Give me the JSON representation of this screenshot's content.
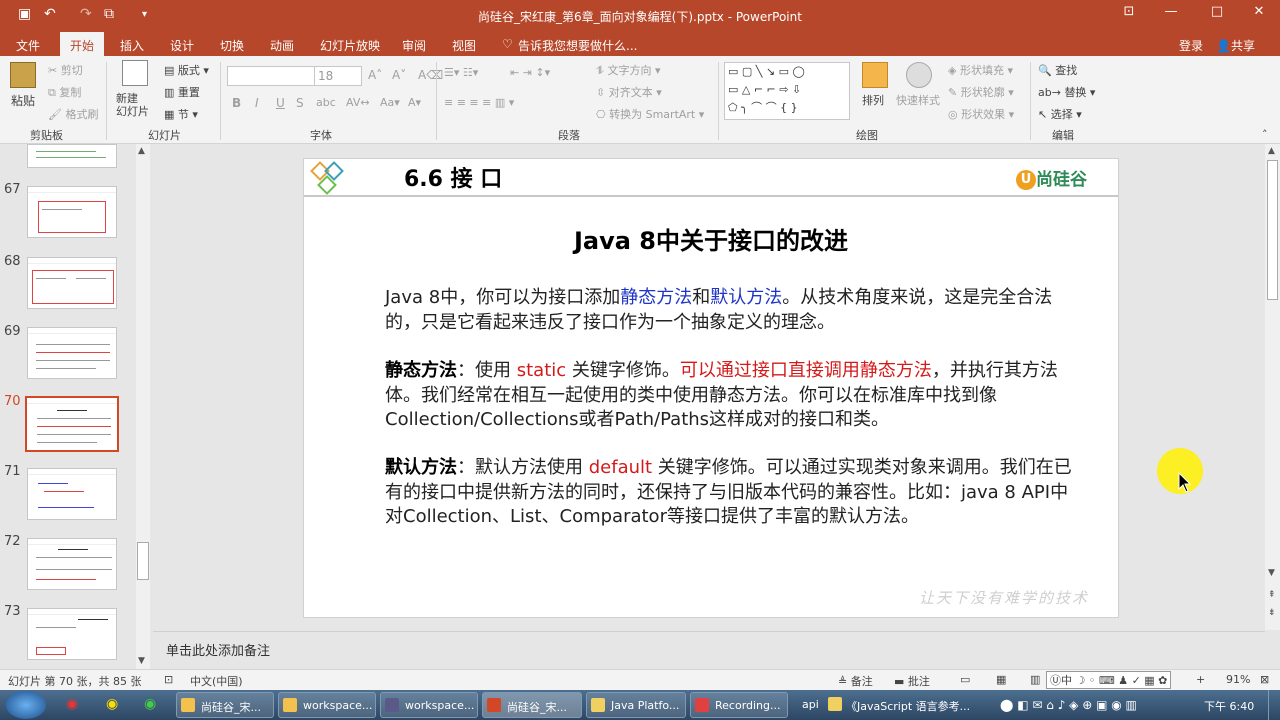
{
  "window": {
    "title": "尚硅谷_宋红康_第6章_面向对象编程(下).pptx - PowerPoint",
    "controls": {
      "restore_ribbon": "⊡",
      "minimize": "—",
      "maximize": "□",
      "close": "✕"
    }
  },
  "quick_access": {
    "save": "save-icon",
    "undo": "undo-icon",
    "redo": "redo-icon"
  },
  "ribbon_tabs": [
    "文件",
    "开始",
    "插入",
    "设计",
    "切换",
    "动画",
    "幻灯片放映",
    "审阅",
    "视图"
  ],
  "tell_me": "告诉我您想要做什么...",
  "account": {
    "login": "登录",
    "share": "共享"
  },
  "ribbon": {
    "clipboard": {
      "name": "剪贴板",
      "paste": "粘贴",
      "cut": "剪切",
      "copy": "复制",
      "format_painter": "格式刷"
    },
    "slides": {
      "name": "幻灯片",
      "new_slide": "新建\n幻灯片",
      "layout": "版式",
      "reset": "重置",
      "section": "节"
    },
    "font": {
      "name": "字体",
      "font_name": "",
      "font_size": "18",
      "bold": "B",
      "italic": "I",
      "underline": "U",
      "strike": "S",
      "shadow": "abc"
    },
    "paragraph": {
      "name": "段落",
      "text_direction": "文字方向",
      "align_text": "对齐文本",
      "smartart": "转换为 SmartArt"
    },
    "drawing": {
      "name": "绘图",
      "arrange": "排列",
      "quick_styles": "快速样式",
      "shape_fill": "形状填充",
      "shape_outline": "形状轮廓",
      "shape_effects": "形状效果"
    },
    "editing": {
      "name": "编辑",
      "find": "查找",
      "replace": "替换",
      "select": "选择"
    }
  },
  "thumbnails": [
    {
      "number": "67"
    },
    {
      "number": "68"
    },
    {
      "number": "69"
    },
    {
      "number": "70",
      "selected": true
    },
    {
      "number": "71"
    },
    {
      "number": "72"
    },
    {
      "number": "73"
    }
  ],
  "slide": {
    "section_title": "6.6  接 口",
    "logo": "尚硅谷",
    "heading": "Java 8中关于接口的改进",
    "p1": {
      "a": "Java 8中，你可以为接口添加",
      "static": "静态方法",
      "b": "和",
      "default": "默认方法",
      "c": "。从技术角度来说，这是完全合法的，只是它看起来违反了接口作为一个抽象定义的理念。"
    },
    "p2": {
      "label": "静态方法",
      "colon": "：使用 ",
      "kw": "static",
      "a": " 关键字修饰。",
      "red": "可以通过接口直接调用静态方法",
      "b": "，并执行其方法体。我们经常在相互一起使用的类中使用静态方法。你可以在标准库中找到像Collection/Collections或者Path/Paths这样成对的接口和类。"
    },
    "p3": {
      "label": "默认方法",
      "colon": "：默认方法使用 ",
      "kw": "default",
      "a": " 关键字修饰。可以通过实现类对象来调用。我们在已有的接口中提供新方法的同时，还保持了与旧版本代码的兼容性。比如：java 8 API中对Collection、List、Comparator等接口提供了丰富的默认方法。"
    },
    "watermark": "让天下没有难学的技术"
  },
  "notes_placeholder": "单击此处添加备注",
  "status": {
    "slide_count": "幻灯片 第 70 张，共 85 张",
    "language": "中文(中国)",
    "notes": "备注",
    "comments": "批注",
    "zoom": "91%",
    "ime": "中"
  },
  "taskbar": {
    "items": [
      {
        "label": "尚硅谷_宋..."
      },
      {
        "label": "workspace..."
      },
      {
        "label": "workspace..."
      },
      {
        "label": "尚硅谷_宋..."
      },
      {
        "label": "Java Platfo..."
      },
      {
        "label": "Recording..."
      },
      {
        "label": "《JavaScript 语言参考..."
      }
    ],
    "api": "api",
    "clock": "下午 6:40"
  },
  "colors": {
    "accent": "#b7472a",
    "link_blue": "#1e34c8",
    "red": "#d41a1a",
    "selection": "#d24726"
  }
}
